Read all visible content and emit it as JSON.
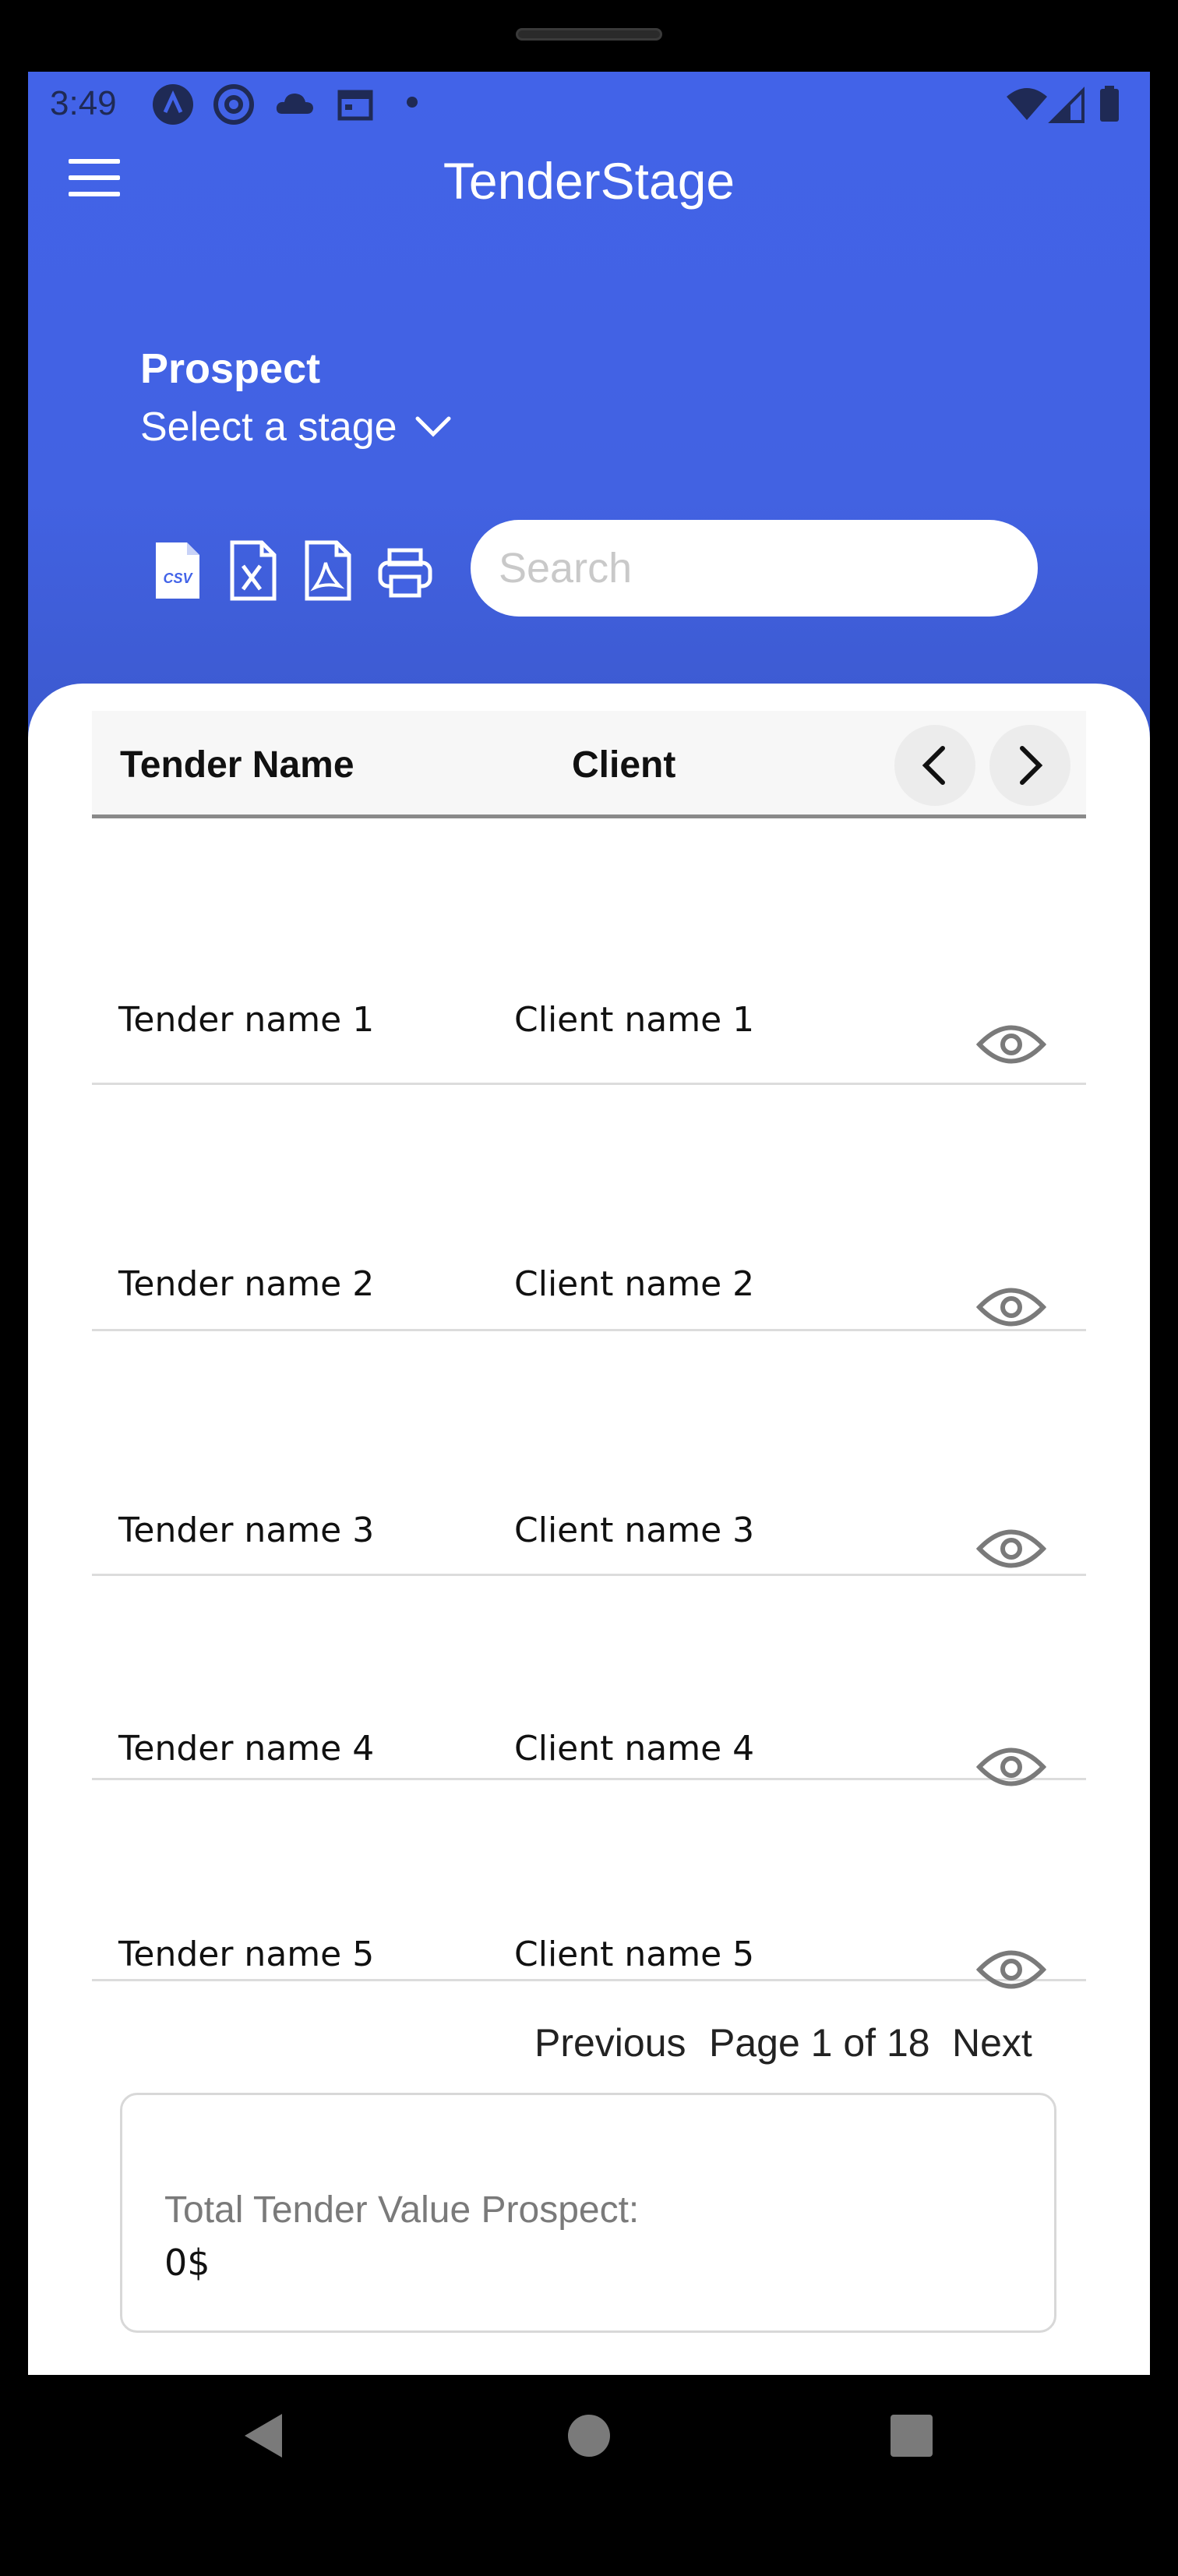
{
  "status_bar": {
    "time": "3:49",
    "icons": [
      "app-a-icon",
      "at-sign-icon",
      "cloud-icon",
      "calendar-icon",
      "dot-icon",
      "wifi-icon",
      "signal-icon",
      "battery-icon"
    ]
  },
  "app_bar": {
    "title": "TenderStage",
    "menu_icon": "hamburger-menu-icon"
  },
  "stage": {
    "title": "Prospect",
    "select_label": "Select a stage"
  },
  "toolbar": {
    "tools": [
      "csv-file-icon",
      "excel-file-icon",
      "pdf-file-icon",
      "printer-icon"
    ],
    "search_placeholder": "Search"
  },
  "table": {
    "headers": {
      "name": "Tender Name",
      "client": "Client"
    },
    "rows": [
      {
        "name": "Tender name 1",
        "client": "Client name 1"
      },
      {
        "name": "Tender name 2",
        "client": "Client name 2"
      },
      {
        "name": "Tender name 3",
        "client": "Client name 3"
      },
      {
        "name": "Tender name 4",
        "client": "Client name 4"
      },
      {
        "name": "Tender name 5",
        "client": "Client name 5"
      }
    ]
  },
  "pagination": {
    "previous": "Previous",
    "page_info": "Page 1 of 18",
    "next": "Next"
  },
  "total": {
    "label": "Total Tender Value Prospect:",
    "value": "0$"
  },
  "colors": {
    "header_blue": "#4263e8",
    "header_blue_dark": "#3b58cc",
    "icon_gray": "#7a7a7a"
  }
}
